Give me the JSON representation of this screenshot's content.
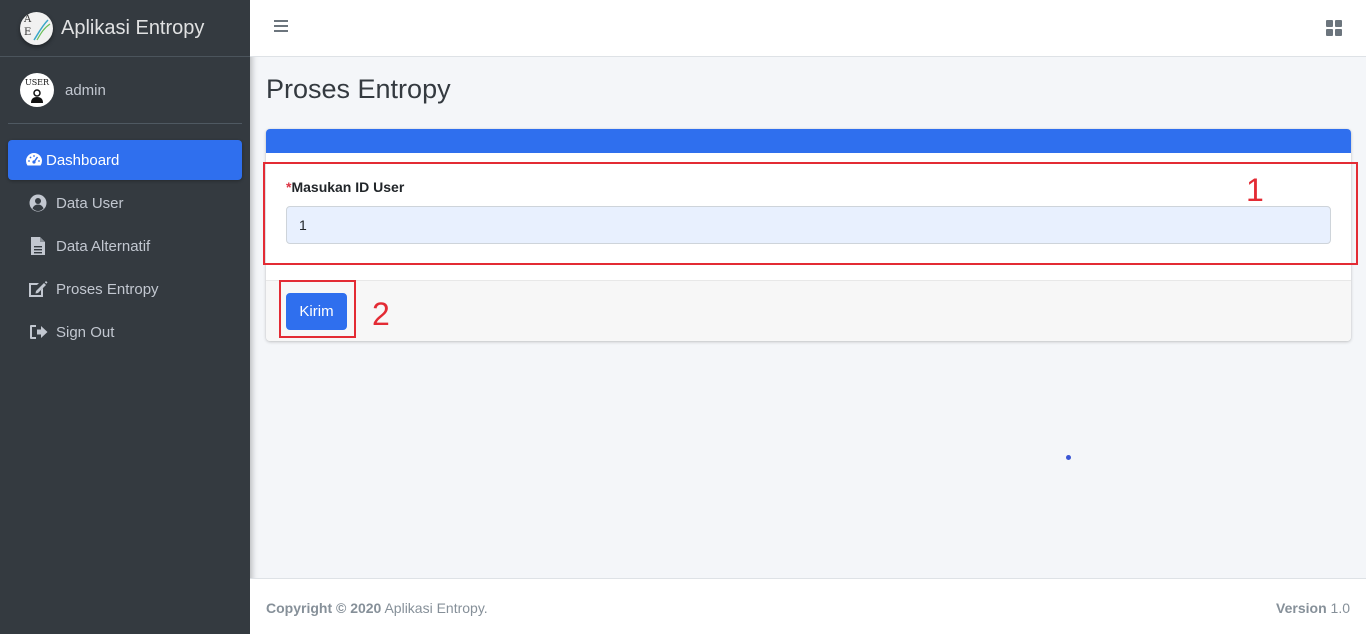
{
  "brand": {
    "title": "Aplikasi Entropy",
    "logo_letter_top": "A",
    "logo_letter_bottom": "E"
  },
  "user": {
    "name": "admin",
    "avatar_text": "USER"
  },
  "sidebar": {
    "items": [
      {
        "label": "Dashboard",
        "icon": "tachometer-icon",
        "active": true
      },
      {
        "label": "Data User",
        "icon": "user-circle-icon"
      },
      {
        "label": "Data Alternatif",
        "icon": "file-icon"
      },
      {
        "label": "Proses Entropy",
        "icon": "edit-icon"
      },
      {
        "label": "Sign Out",
        "icon": "sign-out-icon"
      }
    ]
  },
  "page": {
    "title": "Proses Entropy"
  },
  "form": {
    "required_mark": "*",
    "label": "Masukan ID User",
    "value": "1",
    "submit_label": "Kirim"
  },
  "annotations": {
    "box1_number": "1",
    "box2_number": "2"
  },
  "footer": {
    "copyright_bold": "Copyright © 2020",
    "copyright_text": " Aplikasi Entropy.",
    "version_label": "Version",
    "version_value": " 1.0"
  },
  "colors": {
    "primary": "#2f6fee",
    "sidebar_bg": "#343a40",
    "annotation": "#e32b34"
  }
}
